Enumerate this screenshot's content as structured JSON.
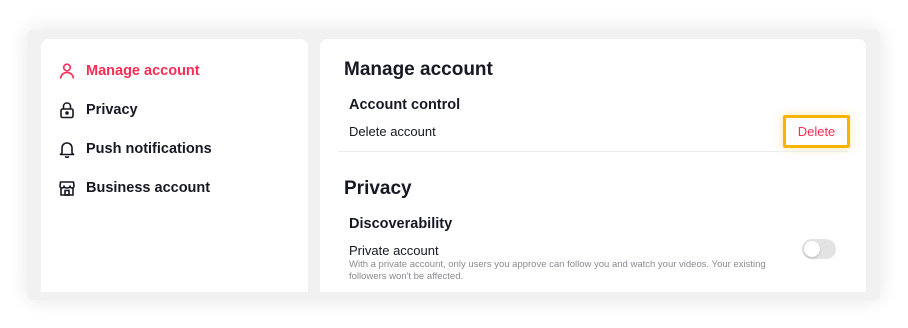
{
  "sidebar": {
    "items": [
      {
        "label": "Manage account",
        "icon": "person-icon",
        "active": true
      },
      {
        "label": "Privacy",
        "icon": "lock-icon",
        "active": false
      },
      {
        "label": "Push notifications",
        "icon": "bell-icon",
        "active": false
      },
      {
        "label": "Business account",
        "icon": "storefront-icon",
        "active": false
      }
    ]
  },
  "main": {
    "manage_account": {
      "title": "Manage account",
      "account_control": {
        "heading": "Account control",
        "delete_label": "Delete account",
        "delete_button": "Delete"
      }
    },
    "privacy": {
      "title": "Privacy",
      "discoverability": {
        "heading": "Discoverability",
        "private_account_label": "Private account",
        "private_account_desc": "With a private account, only users you approve can follow you and watch your videos. Your existing followers won't be affected.",
        "private_account_enabled": false
      }
    }
  },
  "colors": {
    "accent": "#fe2c55",
    "highlight_border": "#f7b500",
    "text": "#161823",
    "muted": "#8a8b91"
  }
}
